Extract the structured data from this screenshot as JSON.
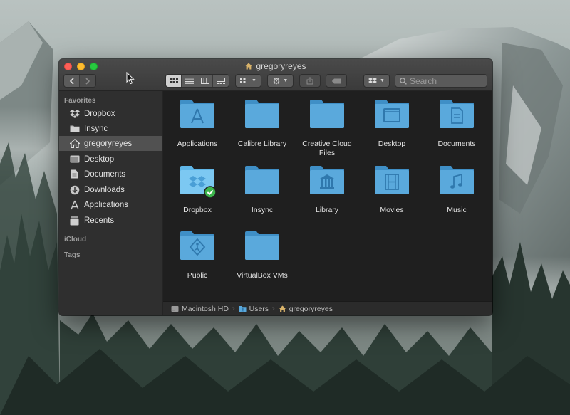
{
  "window": {
    "title": "gregoryreyes"
  },
  "toolbar": {
    "search_placeholder": "Search"
  },
  "sidebar": {
    "favorites_header": "Favorites",
    "items": [
      {
        "label": "Dropbox",
        "icon": "dropbox-icon"
      },
      {
        "label": "Insync",
        "icon": "folder-icon"
      },
      {
        "label": "gregoryreyes",
        "icon": "home-icon",
        "selected": true
      },
      {
        "label": "Desktop",
        "icon": "desktop-icon"
      },
      {
        "label": "Documents",
        "icon": "document-icon"
      },
      {
        "label": "Downloads",
        "icon": "download-icon"
      },
      {
        "label": "Applications",
        "icon": "applications-icon"
      },
      {
        "label": "Recents",
        "icon": "recents-icon"
      }
    ],
    "icloud_header": "iCloud",
    "tags_header": "Tags"
  },
  "files": [
    {
      "name": "Applications",
      "icon": "applications-folder-icon"
    },
    {
      "name": "Calibre Library",
      "icon": "folder-icon"
    },
    {
      "name": "Creative Cloud Files",
      "icon": "folder-icon"
    },
    {
      "name": "Desktop",
      "icon": "desktop-folder-icon"
    },
    {
      "name": "Documents",
      "icon": "documents-folder-icon"
    },
    {
      "name": "Dropbox",
      "icon": "dropbox-folder-icon"
    },
    {
      "name": "Insync",
      "icon": "folder-icon"
    },
    {
      "name": "Library",
      "icon": "library-folder-icon"
    },
    {
      "name": "Movies",
      "icon": "movies-folder-icon"
    },
    {
      "name": "Music",
      "icon": "music-folder-icon"
    },
    {
      "name": "Public",
      "icon": "public-folder-icon"
    },
    {
      "name": "VirtualBox VMs",
      "icon": "folder-icon"
    }
  ],
  "pathbar": {
    "crumbs": [
      "Macintosh HD",
      "Users",
      "gregoryreyes"
    ],
    "separator": "›"
  },
  "colors": {
    "folder": "#5aa9dc",
    "folder_dark": "#3f8fc6",
    "selected_row": "#515151",
    "sync_badge": "#3cb44b"
  }
}
